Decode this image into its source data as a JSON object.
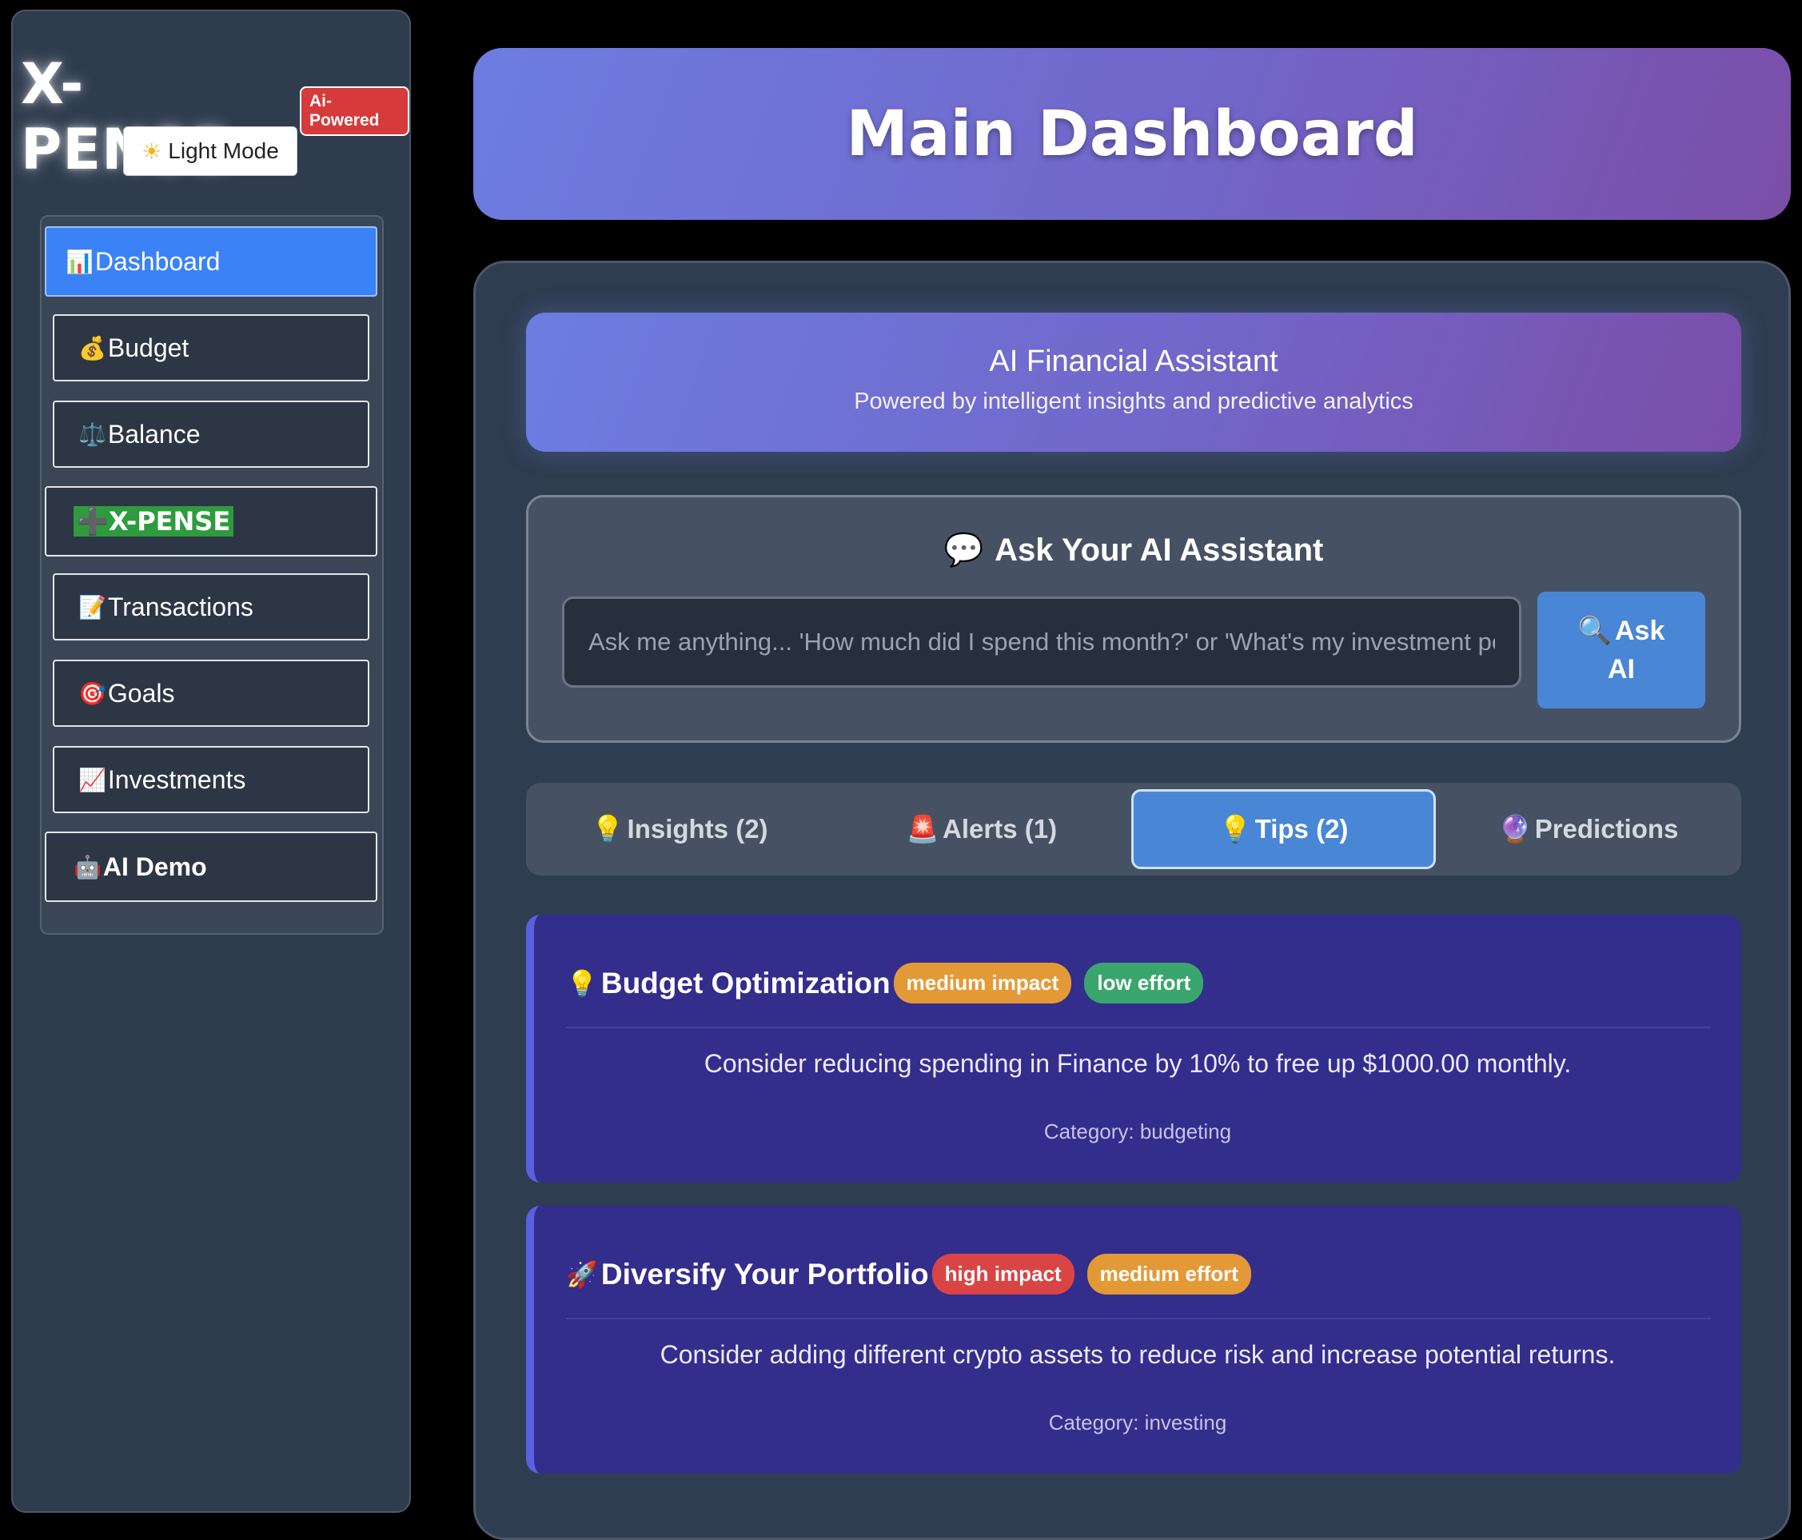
{
  "sidebar": {
    "brand": "X-PENSE",
    "badge": "Ai-Powered",
    "light_mode": "Light Mode",
    "items": [
      {
        "icon": "📊",
        "label": "Dashboard"
      },
      {
        "icon": "💰",
        "label": "Budget"
      },
      {
        "icon": "⚖️",
        "label": "Balance"
      },
      {
        "icon": "➕",
        "label": "X-PENSE"
      },
      {
        "icon": "📝",
        "label": "Transactions"
      },
      {
        "icon": "🎯",
        "label": "Goals"
      },
      {
        "icon": "📈",
        "label": "Investments"
      },
      {
        "icon": "🤖",
        "label": "AI Demo"
      }
    ]
  },
  "header": {
    "title": "Main Dashboard"
  },
  "assistant": {
    "title": "AI Financial Assistant",
    "subtitle": "Powered by intelligent insights and predictive analytics",
    "ask_heading": "Ask Your AI Assistant",
    "ask_placeholder": "Ask me anything... 'How much did I spend this month?' or 'What's my investment performance?'",
    "ask_button_line1": "Ask",
    "ask_button_line2": "AI"
  },
  "tabs": [
    {
      "icon": "💡",
      "label": "Insights (2)"
    },
    {
      "icon": "🚨",
      "label": "Alerts (1)"
    },
    {
      "icon": "💡",
      "label": "Tips (2)"
    },
    {
      "icon": "🔮",
      "label": "Predictions"
    }
  ],
  "tips": [
    {
      "icon": "💡",
      "title": "Budget Optimization",
      "impact": "medium impact",
      "effort": "low effort",
      "description": "Consider reducing spending in Finance by 10% to free up $1000.00 monthly.",
      "category": "Category: budgeting"
    },
    {
      "icon": "🚀",
      "title": "Diversify Your Portfolio",
      "impact": "high impact",
      "effort": "medium effort",
      "description": "Consider adding different crypto assets to reduce risk and increase potential returns.",
      "category": "Category: investing"
    }
  ]
}
